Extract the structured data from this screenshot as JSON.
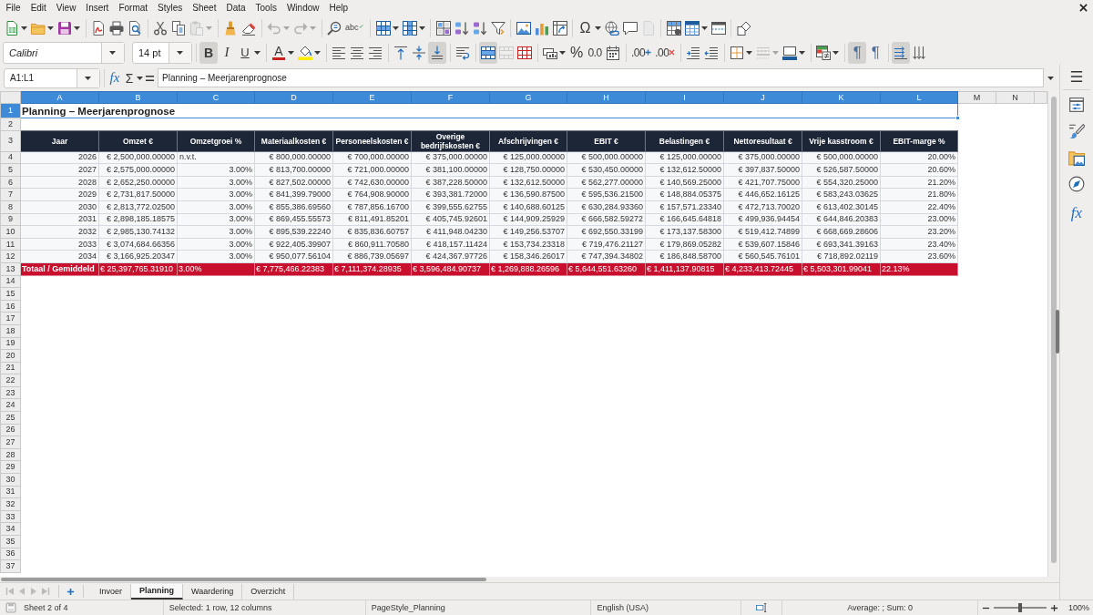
{
  "menu_bar": [
    "File",
    "Edit",
    "View",
    "Insert",
    "Format",
    "Styles",
    "Sheet",
    "Data",
    "Tools",
    "Window",
    "Help"
  ],
  "standard_toolbar": {
    "paste": {
      "disabled": true
    },
    "undo": {
      "disabled": true
    },
    "redo": {
      "disabled": true
    },
    "spelling": {
      "label": "abc"
    },
    "special_character": {
      "label": "Ω"
    },
    "header_footer": {
      "disabled": true
    }
  },
  "formatting_toolbar": {
    "font_name": "Calibri",
    "font_size": "14 pt",
    "bold": {
      "label": "B",
      "pressed": true
    },
    "italic": {
      "label": "I"
    },
    "underline": {
      "label": "U"
    },
    "font_color": {
      "label": "A"
    },
    "align_bottom": {
      "pressed": true
    },
    "merge_and_center": {
      "pressed": true
    },
    "merge_cells": {
      "disabled": true
    },
    "percent": {
      "label": "%"
    },
    "number_format": {
      "label": "0.0"
    },
    "add_decimal": {
      "label": ".00"
    },
    "delete_decimal": {
      "label": ".00"
    },
    "border_style": {
      "disabled": true
    },
    "left_to_right": {
      "label": "¶",
      "pressed": true
    },
    "right_to_left": {
      "label": "¶"
    },
    "text_left_to_right": {
      "pressed": true
    }
  },
  "formula_bar": {
    "name_box": "A1:L1",
    "function_wizard_label": "fx",
    "sum_label": "Σ",
    "formula": "Planning – Meerjarenprognose"
  },
  "sheet": {
    "columns": [
      {
        "label": "A",
        "selected": true
      },
      {
        "label": "B",
        "selected": true
      },
      {
        "label": "C",
        "selected": true
      },
      {
        "label": "D",
        "selected": true
      },
      {
        "label": "E",
        "selected": true
      },
      {
        "label": "F",
        "selected": true
      },
      {
        "label": "G",
        "selected": true
      },
      {
        "label": "H",
        "selected": true
      },
      {
        "label": "I",
        "selected": true
      },
      {
        "label": "J",
        "selected": true
      },
      {
        "label": "K",
        "selected": true
      },
      {
        "label": "L",
        "selected": true
      },
      {
        "label": "M",
        "selected": false
      },
      {
        "label": "N",
        "selected": false
      }
    ],
    "rows": [
      {
        "label": "1",
        "selected": true,
        "kind": "title",
        "cells": [
          "Planning – Meerjarenprognose"
        ]
      },
      {
        "label": "2",
        "selected": false,
        "kind": "blank"
      },
      {
        "label": "3",
        "selected": false,
        "kind": "header",
        "cells": [
          "Jaar",
          "Omzet €",
          "Omzetgroei %",
          "Materiaalkosten €",
          "Personeelskosten €",
          "Overige bedrijfskosten €",
          "Afschrijvingen €",
          "EBIT €",
          "Belastingen €",
          "Nettoresultaat €",
          "Vrije kasstroom €",
          "EBIT-marge %"
        ]
      },
      {
        "label": "4",
        "selected": false,
        "kind": "data",
        "cells": [
          "2026",
          "€ 2,500,000.00000",
          {
            "text": "n.v.t.",
            "kind": "text"
          },
          "€ 800,000.00000",
          "€ 700,000.00000",
          "€ 375,000.00000",
          "€ 125,000.00000",
          "€ 500,000.00000",
          "€ 125,000.00000",
          "€ 375,000.00000",
          "€ 500,000.00000",
          "20.00%"
        ]
      },
      {
        "label": "5",
        "selected": false,
        "kind": "data",
        "cells": [
          "2027",
          "€ 2,575,000.00000",
          "3.00%",
          "€ 813,700.00000",
          "€ 721,000.00000",
          "€ 381,100.00000",
          "€ 128,750.00000",
          "€ 530,450.00000",
          "€ 132,612.50000",
          "€ 397,837.50000",
          "€ 526,587.50000",
          "20.60%"
        ]
      },
      {
        "label": "6",
        "selected": false,
        "kind": "data",
        "cells": [
          "2028",
          "€ 2,652,250.00000",
          "3.00%",
          "€ 827,502.00000",
          "€ 742,630.00000",
          "€ 387,228.50000",
          "€ 132,612.50000",
          "€ 562,277.00000",
          "€ 140,569.25000",
          "€ 421,707.75000",
          "€ 554,320.25000",
          "21.20%"
        ]
      },
      {
        "label": "7",
        "selected": false,
        "kind": "data",
        "cells": [
          "2029",
          "€ 2,731,817.50000",
          "3.00%",
          "€ 841,399.79000",
          "€ 764,908.90000",
          "€ 393,381.72000",
          "€ 136,590.87500",
          "€ 595,536.21500",
          "€ 148,884.05375",
          "€ 446,652.16125",
          "€ 583,243.03625",
          "21.80%"
        ]
      },
      {
        "label": "8",
        "selected": false,
        "kind": "data",
        "cells": [
          "2030",
          "€ 2,813,772.02500",
          "3.00%",
          "€ 855,386.69560",
          "€ 787,856.16700",
          "€ 399,555.62755",
          "€ 140,688.60125",
          "€ 630,284.93360",
          "€ 157,571.23340",
          "€ 472,713.70020",
          "€ 613,402.30145",
          "22.40%"
        ]
      },
      {
        "label": "9",
        "selected": false,
        "kind": "data",
        "cells": [
          "2031",
          "€ 2,898,185.18575",
          "3.00%",
          "€ 869,455.55573",
          "€ 811,491.85201",
          "€ 405,745.92601",
          "€ 144,909.25929",
          "€ 666,582.59272",
          "€ 166,645.64818",
          "€ 499,936.94454",
          "€ 644,846.20383",
          "23.00%"
        ]
      },
      {
        "label": "10",
        "selected": false,
        "kind": "data",
        "cells": [
          "2032",
          "€ 2,985,130.74132",
          "3.00%",
          "€ 895,539.22240",
          "€ 835,836.60757",
          "€ 411,948.04230",
          "€ 149,256.53707",
          "€ 692,550.33199",
          "€ 173,137.58300",
          "€ 519,412.74899",
          "€ 668,669.28606",
          "23.20%"
        ]
      },
      {
        "label": "11",
        "selected": false,
        "kind": "data",
        "cells": [
          "2033",
          "€ 3,074,684.66356",
          "3.00%",
          "€ 922,405.39907",
          "€ 860,911.70580",
          "€ 418,157.11424",
          "€ 153,734.23318",
          "€ 719,476.21127",
          "€ 179,869.05282",
          "€ 539,607.15846",
          "€ 693,341.39163",
          "23.40%"
        ]
      },
      {
        "label": "12",
        "selected": false,
        "kind": "data",
        "cells": [
          "2034",
          "€ 3,166,925.20347",
          "3.00%",
          "€ 950,077.56104",
          "€ 886,739.05697",
          "€ 424,367.97726",
          "€ 158,346.26017",
          "€ 747,394.34802",
          "€ 186,848.58700",
          "€ 560,545.76101",
          "€ 718,892.02119",
          "23.60%"
        ]
      },
      {
        "label": "13",
        "selected": false,
        "kind": "total",
        "cells": [
          "Totaal / Gemiddeld",
          "€ 25,397,765.31910",
          "3.00%",
          "€ 7,775,466.22383",
          "€ 7,111,374.28935",
          "€ 3,596,484.90737",
          "€ 1,269,888.26596",
          "€ 5,644,551.63260",
          "€ 1,411,137.90815",
          "€ 4,233,413.72445",
          "€ 5,503,301.99041",
          "22.13%"
        ]
      },
      {
        "label": "14",
        "selected": false,
        "kind": "blank"
      },
      {
        "label": "15",
        "selected": false,
        "kind": "blank"
      },
      {
        "label": "16",
        "selected": false,
        "kind": "blank"
      },
      {
        "label": "17",
        "selected": false,
        "kind": "blank"
      },
      {
        "label": "18",
        "selected": false,
        "kind": "blank"
      },
      {
        "label": "19",
        "selected": false,
        "kind": "blank"
      },
      {
        "label": "20",
        "selected": false,
        "kind": "blank"
      },
      {
        "label": "21",
        "selected": false,
        "kind": "blank"
      },
      {
        "label": "22",
        "selected": false,
        "kind": "blank"
      },
      {
        "label": "23",
        "selected": false,
        "kind": "blank"
      },
      {
        "label": "24",
        "selected": false,
        "kind": "blank"
      },
      {
        "label": "25",
        "selected": false,
        "kind": "blank"
      },
      {
        "label": "26",
        "selected": false,
        "kind": "blank"
      },
      {
        "label": "27",
        "selected": false,
        "kind": "blank"
      },
      {
        "label": "28",
        "selected": false,
        "kind": "blank"
      },
      {
        "label": "29",
        "selected": false,
        "kind": "blank"
      },
      {
        "label": "30",
        "selected": false,
        "kind": "blank"
      },
      {
        "label": "31",
        "selected": false,
        "kind": "blank"
      },
      {
        "label": "32",
        "selected": false,
        "kind": "blank"
      },
      {
        "label": "33",
        "selected": false,
        "kind": "blank"
      },
      {
        "label": "34",
        "selected": false,
        "kind": "blank"
      },
      {
        "label": "35",
        "selected": false,
        "kind": "blank"
      },
      {
        "label": "36",
        "selected": false,
        "kind": "blank"
      },
      {
        "label": "37",
        "selected": false,
        "kind": "blank"
      }
    ]
  },
  "sheet_tabs": [
    {
      "label": "Invoer",
      "selected": false
    },
    {
      "label": "Planning",
      "selected": true
    },
    {
      "label": "Waardering",
      "selected": false
    },
    {
      "label": "Overzicht",
      "selected": false
    }
  ],
  "sidebar": {
    "functions_label": "fx"
  },
  "status_bar": {
    "sheet_position": "Sheet 2 of 4",
    "selection": "Selected: 1 row, 12 columns",
    "page_style": "PageStyle_Planning",
    "language": "English (USA)",
    "summary": "Average: ; Sum: 0",
    "zoom": {
      "level": 0.5,
      "reading": "100%"
    }
  }
}
